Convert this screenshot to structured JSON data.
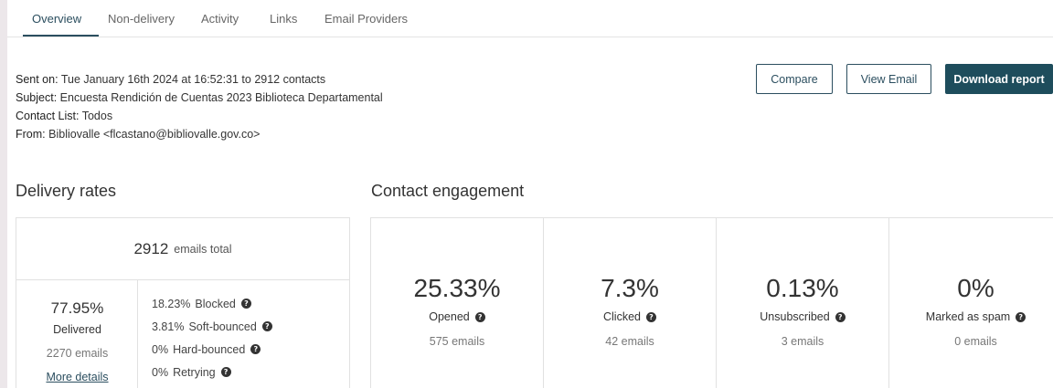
{
  "tabs": [
    {
      "label": "Overview"
    },
    {
      "label": "Non-delivery"
    },
    {
      "label": "Activity"
    },
    {
      "label": "Links"
    },
    {
      "label": "Email Providers"
    }
  ],
  "meta": {
    "sent_key": "Sent on:",
    "sent_value": "Tue January 16th 2024 at 16:52:31 to 2912 contacts",
    "subject_key": "Subject:",
    "subject_value": "Encuesta Rendición de Cuentas 2023 Biblioteca Departamental",
    "list_key": "Contact List:",
    "list_value": "Todos",
    "from_key": "From:",
    "from_value": "Bibliovalle <flcastano@bibliovalle.gov.co>"
  },
  "actions": {
    "compare": "Compare",
    "view_email": "View Email",
    "download": "Download report"
  },
  "delivery": {
    "title": "Delivery rates",
    "total": "2912",
    "total_label": "emails total",
    "delivered_pct": "77.95%",
    "delivered_label": "Delivered",
    "delivered_emails": "2270 emails",
    "more_details": "More details",
    "rates": [
      {
        "pct": "18.23%",
        "label": "Blocked"
      },
      {
        "pct": "3.81%",
        "label": "Soft-bounced"
      },
      {
        "pct": "0%",
        "label": "Hard-bounced"
      },
      {
        "pct": "0%",
        "label": "Retrying"
      }
    ]
  },
  "engagement": {
    "title": "Contact engagement",
    "items": [
      {
        "pct": "25.33%",
        "label": "Opened",
        "emails": "575 emails"
      },
      {
        "pct": "7.3%",
        "label": "Clicked",
        "emails": "42 emails"
      },
      {
        "pct": "0.13%",
        "label": "Unsubscribed",
        "emails": "3 emails"
      },
      {
        "pct": "0%",
        "label": "Marked as spam",
        "emails": "0 emails"
      }
    ]
  },
  "colors": {
    "accent": "#2b4e5f",
    "primary_button": "#1e4d5c"
  }
}
